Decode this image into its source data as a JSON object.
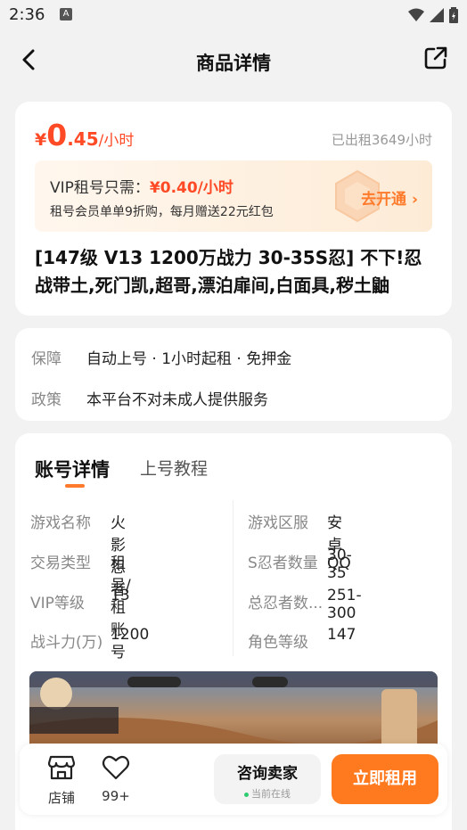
{
  "status_bar": {
    "time": "2:36",
    "notif_icon": "A"
  },
  "nav": {
    "title": "商品详情"
  },
  "price": {
    "symbol": "¥",
    "integer": "0",
    "decimal": ".45",
    "unit": "/小时",
    "rented": "已出租3649小时"
  },
  "vip": {
    "label": "VIP租号只需：",
    "vip_price": "¥0.40/小时",
    "desc": "租号会员单单9折购，每月赠送22元红包",
    "cta": "去开通"
  },
  "product_title": "[147级 V13 1200万战力 30-35S忍] 不下!忍战带土,死门凯,超哥,漂泊扉间,白面具,秽土鼬",
  "policy": {
    "rows": [
      {
        "key": "保障",
        "value": "自动上号 · 1小时起租 · 免押金"
      },
      {
        "key": "政策",
        "value": "本平台不对未成人提供服务"
      }
    ]
  },
  "tabs": {
    "active": "账号详情",
    "other": "上号教程"
  },
  "attributes": {
    "left": [
      {
        "key": "游戏名称",
        "value": "火影忍者"
      },
      {
        "key": "交易类型",
        "value": "租号/租账号"
      },
      {
        "key": "VIP等级",
        "value": "13"
      },
      {
        "key": "战斗力(万)",
        "value": "1200"
      }
    ],
    "right": [
      {
        "key": "游戏区服",
        "value": "安卓QQ"
      },
      {
        "key": "S忍者数量",
        "value": "30-35"
      },
      {
        "key": "总忍者数...",
        "value": "251-300"
      },
      {
        "key": "角色等级",
        "value": "147"
      }
    ]
  },
  "bottom": {
    "shop_label": "店铺",
    "fav_count": "99+",
    "consult_title": "咨询卖家",
    "consult_status": "当前在线",
    "rent_button": "立即租用"
  },
  "colors": {
    "accent": "#ff7a1f",
    "price": "#ff4a25"
  }
}
